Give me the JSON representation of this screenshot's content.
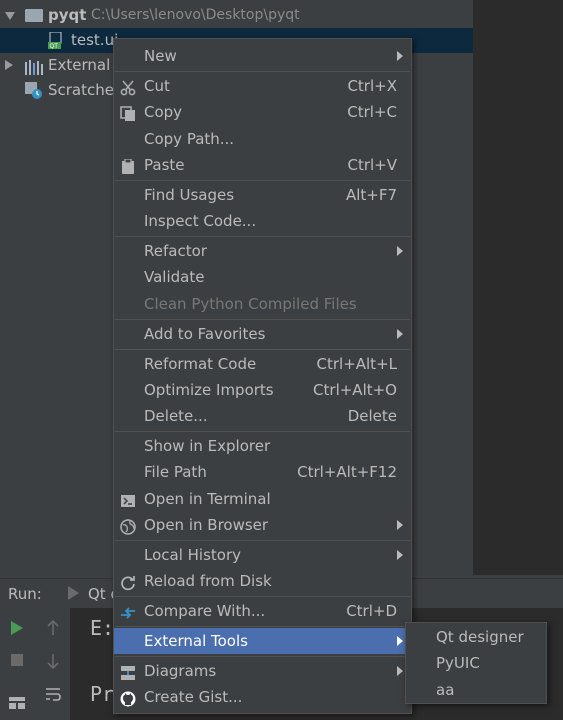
{
  "tree": {
    "root_name": "pyqt",
    "root_path": "C:\\Users\\lenovo\\Desktop\\pyqt",
    "file_name": "test.ui",
    "external_label": "External L",
    "scratches_label": "Scratches"
  },
  "run": {
    "label": "Run:",
    "tab_label": "Qt d",
    "console_line1": "E:",
    "console_line2": "Pr"
  },
  "menu": {
    "new": "New",
    "cut": "Cut",
    "cut_sc": "Ctrl+X",
    "copy": "Copy",
    "copy_sc": "Ctrl+C",
    "copy_path": "Copy Path...",
    "paste": "Paste",
    "paste_sc": "Ctrl+V",
    "find_usages": "Find Usages",
    "find_usages_sc": "Alt+F7",
    "inspect_code": "Inspect Code...",
    "refactor": "Refactor",
    "validate": "Validate",
    "clean_python": "Clean Python Compiled Files",
    "add_favorites": "Add to Favorites",
    "reformat": "Reformat Code",
    "reformat_sc": "Ctrl+Alt+L",
    "optimize": "Optimize Imports",
    "optimize_sc": "Ctrl+Alt+O",
    "delete": "Delete...",
    "delete_sc": "Delete",
    "show_explorer": "Show in Explorer",
    "file_path": "File Path",
    "file_path_sc": "Ctrl+Alt+F12",
    "open_terminal": "Open in Terminal",
    "open_browser": "Open in Browser",
    "local_history": "Local History",
    "reload_disk": "Reload from Disk",
    "compare_with": "Compare With...",
    "compare_with_sc": "Ctrl+D",
    "external_tools": "External Tools",
    "diagrams": "Diagrams",
    "create_gist": "Create Gist..."
  },
  "submenu": {
    "items": [
      "Qt designer",
      "PyUIC",
      "aa"
    ]
  },
  "colors": {
    "highlight": "#4b6eaf",
    "background": "#3c3f41"
  }
}
